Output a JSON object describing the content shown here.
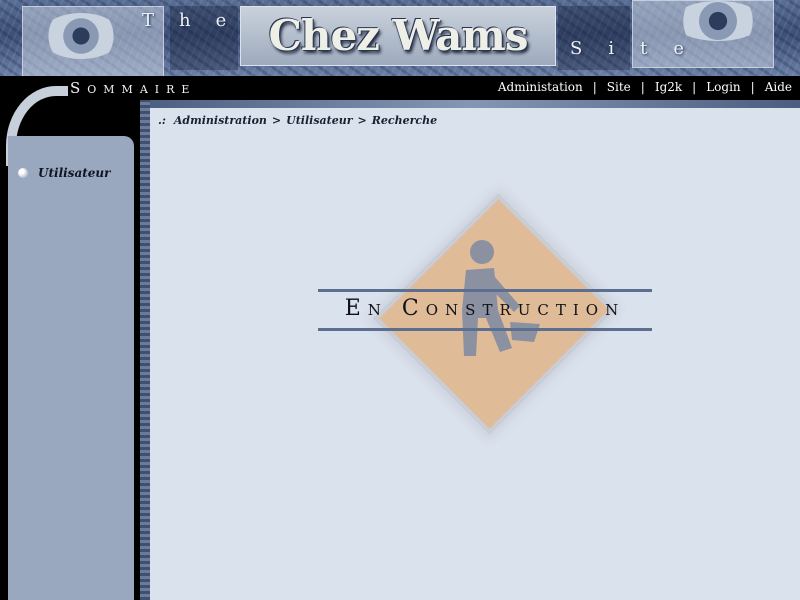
{
  "banner": {
    "title": "Chez Wams",
    "tagline_the": "The",
    "tagline_site": "Site"
  },
  "menubar": {
    "sommaire": "Sommaire",
    "links": [
      "Administation",
      "Site",
      "Ig2k",
      "Login",
      "Aide"
    ],
    "separator": "|"
  },
  "sidebar": {
    "items": [
      {
        "label": "Utilisateur"
      }
    ]
  },
  "breadcrumb": {
    "prefix": ".:",
    "items": [
      "Administration",
      "Utilisateur",
      "Recherche"
    ],
    "separator": ">"
  },
  "main": {
    "construction_title": "En Construction"
  },
  "colors": {
    "content_bg": "#dae2ee",
    "sidebar_bg": "#99a8bf",
    "sign_orange": "#e0b890",
    "rule": "#5d6f90"
  }
}
